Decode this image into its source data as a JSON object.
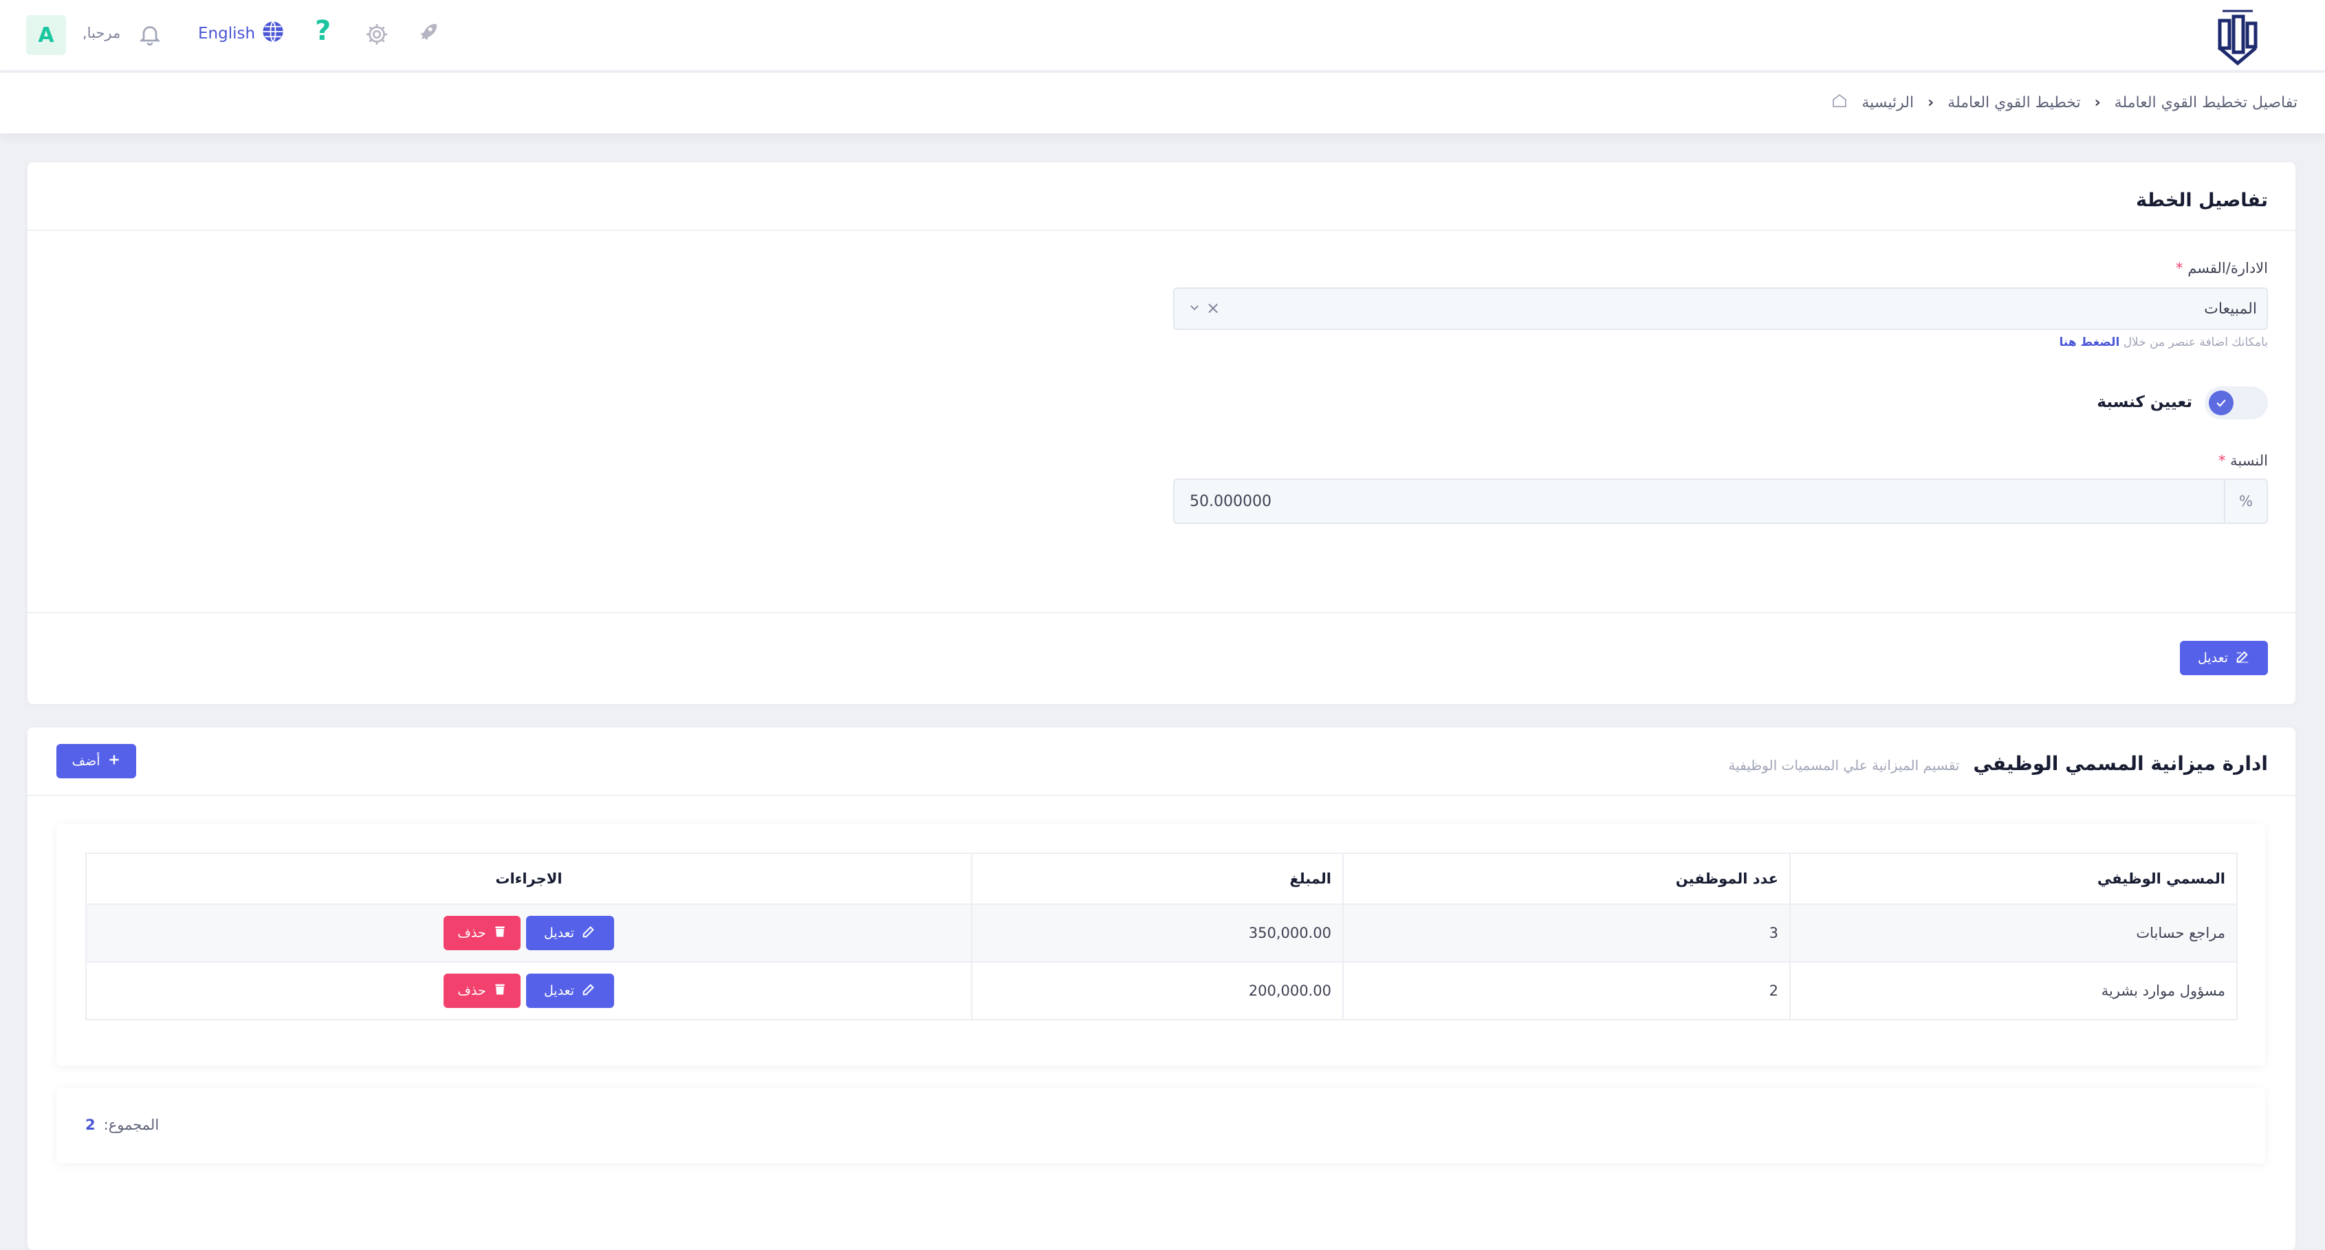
{
  "header": {
    "avatar_letter": "A",
    "greeting": "مرحبا,",
    "language": "English",
    "help_glyph": "?",
    "icons": [
      "bell-icon",
      "globe-icon",
      "help-icon",
      "gear-icon",
      "rocket-icon",
      "logo"
    ]
  },
  "breadcrumb": {
    "home": "الرئيسية",
    "level1": "تخطيط القوي العاملة",
    "current": "تفاصيل تخطيط القوي العاملة"
  },
  "plan_details": {
    "title": "تفاصيل الخطة",
    "department_label": "الادارة/القسم",
    "required_mark": "*",
    "department_value": "المبيعات",
    "hint_text": "بامكانك اضافة عنصر من خلال",
    "hint_link": "الضغط هنا",
    "toggle_label": "تعيين كنسبة",
    "toggle_on": true,
    "percentage_label": "النسبة",
    "percentage_addon": "%",
    "percentage_value": "50.000000",
    "edit_button": "تعديل"
  },
  "budget": {
    "title": "ادارة ميزانية المسمي الوظيفي",
    "subtitle": "تقسيم الميزانية علي المسميات الوظيفية",
    "add_button": "أضف",
    "columns": {
      "job_title": "المسمي الوظيفي",
      "employees": "عدد الموظفين",
      "amount": "المبلغ",
      "actions": "الاجراءات"
    },
    "rows": [
      {
        "job_title": "مراجع حسابات",
        "employees": "3",
        "amount": "350,000.00",
        "edit": "تعديل",
        "delete": "حذف"
      },
      {
        "job_title": "مسؤول موارد بشرية",
        "employees": "2",
        "amount": "200,000.00",
        "edit": "تعديل",
        "delete": "حذف"
      }
    ],
    "total_label": "المجموع:",
    "total_value": "2"
  },
  "colors": {
    "primary": "#5561e8",
    "danger": "#f1416c",
    "success": "#1bc5a0",
    "background": "#eef0f4"
  }
}
